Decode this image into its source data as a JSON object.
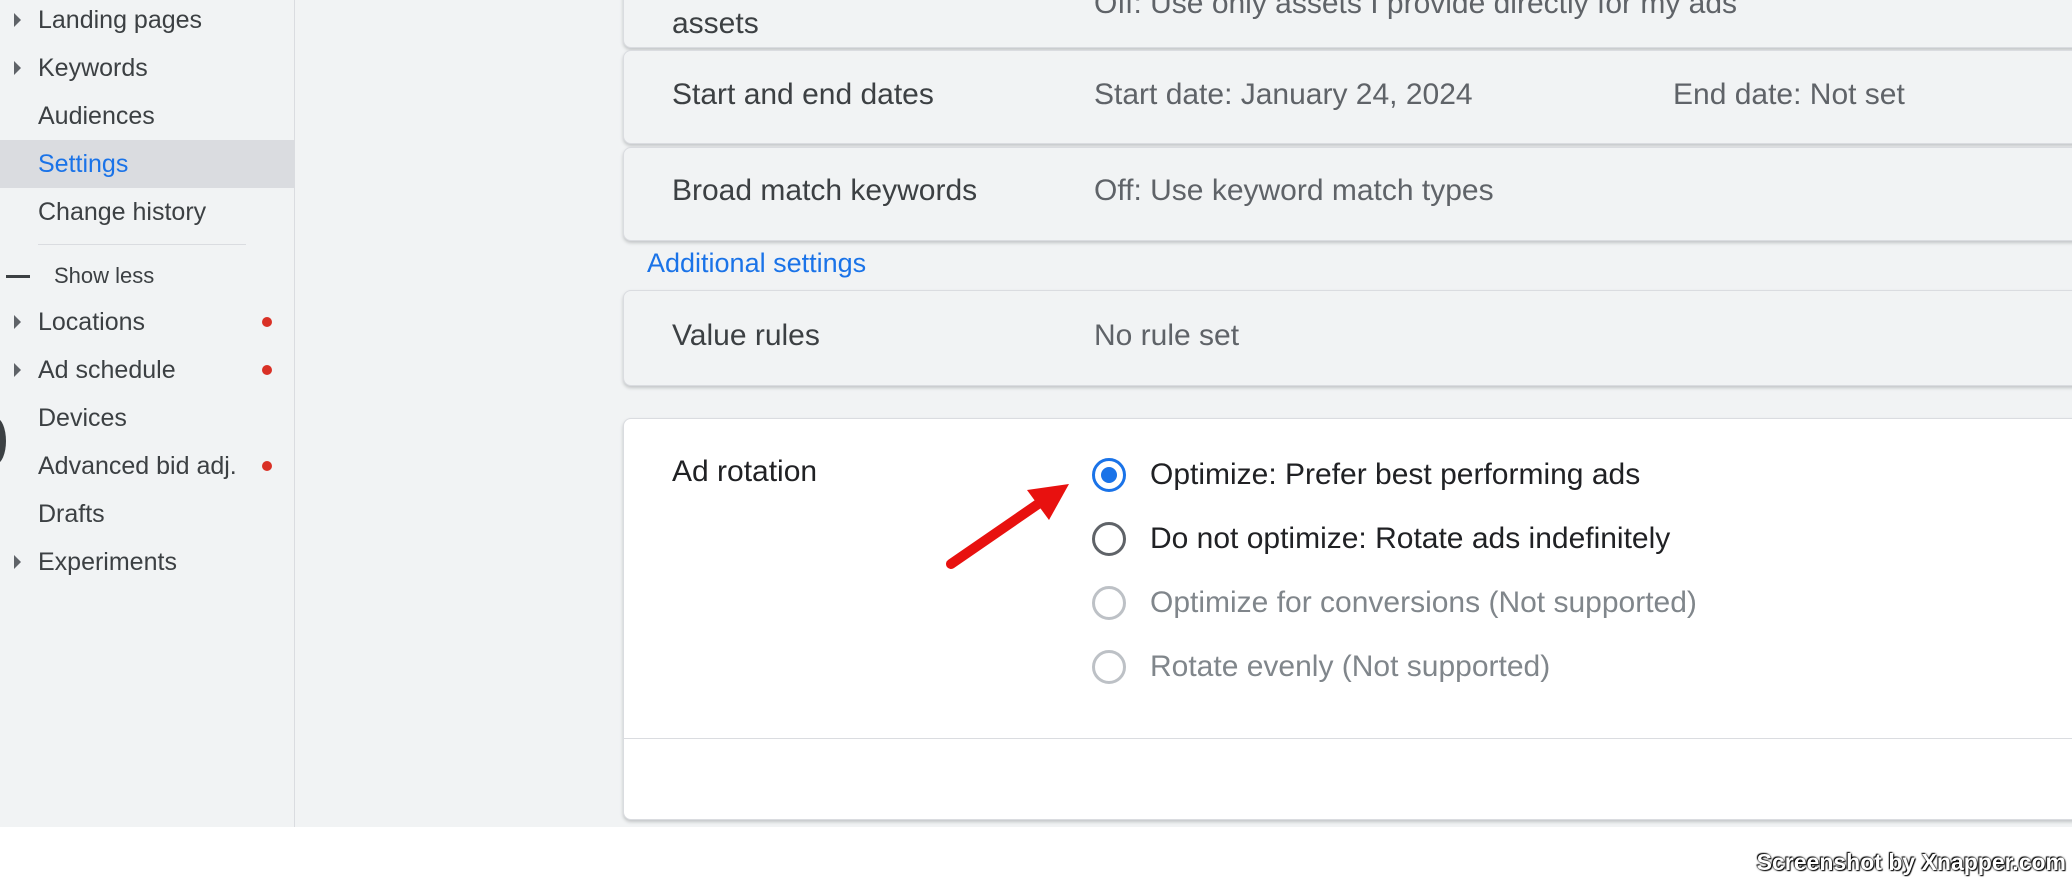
{
  "sidebar": {
    "items": [
      {
        "label": "Landing pages",
        "caret": true,
        "dot": false
      },
      {
        "label": "Keywords",
        "caret": true,
        "dot": false
      },
      {
        "label": "Audiences",
        "caret": false,
        "dot": false
      },
      {
        "label": "Settings",
        "caret": false,
        "dot": false,
        "selected": true
      },
      {
        "label": "Change history",
        "caret": false,
        "dot": false
      }
    ],
    "show_less_label": "Show less",
    "more_items": [
      {
        "label": "Locations",
        "caret": true,
        "dot": true
      },
      {
        "label": "Ad schedule",
        "caret": true,
        "dot": true
      },
      {
        "label": "Devices",
        "caret": false,
        "dot": false
      },
      {
        "label": "Advanced bid adj.",
        "caret": false,
        "dot": true
      },
      {
        "label": "Drafts",
        "caret": false,
        "dot": false
      },
      {
        "label": "Experiments",
        "caret": true,
        "dot": false
      }
    ]
  },
  "settings": {
    "assets_row": {
      "title": "assets",
      "value": "Off: Use only assets I provide directly for my ads"
    },
    "dates_row": {
      "title": "Start and end dates",
      "start": "Start date: January 24, 2024",
      "end": "End date: Not set"
    },
    "broad_match_row": {
      "title": "Broad match keywords",
      "value": "Off: Use keyword match types"
    },
    "additional_settings_label": "Additional settings",
    "value_rules_row": {
      "title": "Value rules",
      "value": "No rule set"
    },
    "ad_rotation": {
      "title": "Ad rotation",
      "options": [
        {
          "label": "Optimize: Prefer best performing ads",
          "checked": true,
          "disabled": false
        },
        {
          "label": "Do not optimize: Rotate ads indefinitely",
          "checked": false,
          "disabled": false
        },
        {
          "label": "Optimize for conversions (Not supported)",
          "checked": false,
          "disabled": true
        },
        {
          "label": "Rotate evenly (Not supported)",
          "checked": false,
          "disabled": true
        }
      ]
    }
  },
  "annotation": {
    "arrow_color": "#e8110f"
  },
  "watermark": "Screenshot by Xnapper.com",
  "colors": {
    "accent": "#1a73e8",
    "alert_dot": "#d93025",
    "background": "#f1f3f4"
  }
}
